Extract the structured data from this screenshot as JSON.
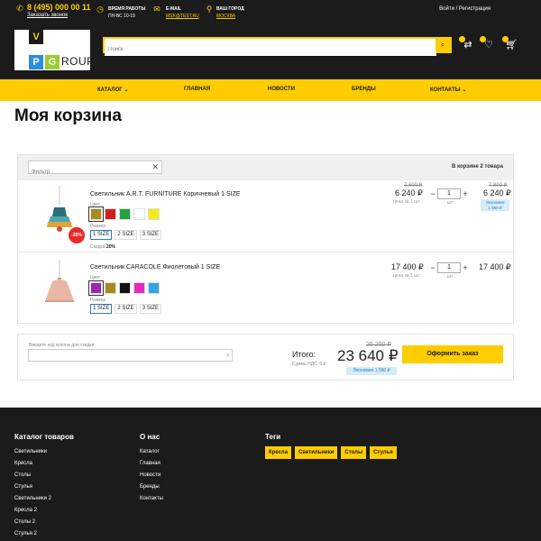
{
  "header": {
    "phone": "8 (495) 000 00 11",
    "callback": "Заказать звонок",
    "work_label": "Время работы",
    "work_value": "ПН-ВС 10-19",
    "email_label": "E-mail",
    "email_value": "MSK@TEST.RU",
    "city_label": "Ваш город",
    "city_value": "МОСКВА",
    "login": "Войти / Регистрация"
  },
  "logo": {
    "letters": [
      "V",
      "P",
      "G"
    ],
    "word": "ROUP"
  },
  "search": {
    "placeholder": "Поиск"
  },
  "nav": [
    "КАТАЛОГ",
    "ГЛАВНАЯ",
    "НОВОСТИ",
    "БРЕНДЫ",
    "КОНТАКТЫ"
  ],
  "page_title": "Моя корзина",
  "cart": {
    "filter_placeholder": "Фильтр",
    "count": "В корзине 2 товара",
    "items": [
      {
        "name": "Светильник A.R.T. FURNITURE Коричневый 1 SIZE",
        "color_label": "Цвет",
        "colors": [
          "#a88b1e",
          "#d61d1d",
          "#21a33a",
          "#ffffff",
          "#f2ec14"
        ],
        "size_label": "Размер",
        "sizes": [
          "1 SIZE",
          "2 SIZE",
          "3 SIZE"
        ],
        "discount": "-20%",
        "sale_label": "Скидка",
        "sale_value": "20%",
        "old_price": "7 800 ₽",
        "price": "6 240 ₽",
        "unit": "цена за 1 шт",
        "qty": "1",
        "qty_unit": "шт",
        "sum_old": "7 800 ₽",
        "sum": "6 240 ₽",
        "economy_label": "Экономия",
        "economy_value": "1 560 ₽"
      },
      {
        "name": "Светильник CARACOLE Фиолетовый 1 SIZE",
        "color_label": "Цвет",
        "colors": [
          "#9b27b0",
          "#a88b1e",
          "#111111",
          "#e52bbf",
          "#34a5e8"
        ],
        "size_label": "Размер",
        "sizes": [
          "1 SIZE",
          "2 SIZE",
          "3 SIZE"
        ],
        "price": "17 400 ₽",
        "unit": "цена за 1 шт",
        "qty": "1",
        "qty_unit": "шт",
        "sum": "17 400 ₽"
      }
    ]
  },
  "coupon": {
    "label": "Введите код купона для скидки:",
    "total_label": "Итого:",
    "vat": "Сумма НДС: 0 ₽",
    "total_old": "25 200 ₽",
    "total": "23 640 ₽",
    "economy": "Экономия 1 560 ₽",
    "order_button": "Оформить заказ"
  },
  "footer": {
    "catalog_title": "Каталог товаров",
    "catalog_links": [
      "Светильники",
      "Кресла",
      "Столы",
      "Стулья",
      "Светильники 2",
      "Кресла 2",
      "Столы 2",
      "Стулья 2"
    ],
    "about_title": "О нас",
    "about_links": [
      "Каталог",
      "Главная",
      "Новости",
      "Бренды",
      "Контакты"
    ],
    "tags_title": "Теги",
    "tags": [
      "Кресла",
      "Светильники",
      "Столы",
      "Стулья"
    ]
  },
  "colors": {
    "accent": "#ffcc00",
    "dark": "#1b1b1b",
    "sale": "#e52b2b",
    "economy_bg": "#d6ecf7",
    "economy_text": "#2c7ac9"
  }
}
